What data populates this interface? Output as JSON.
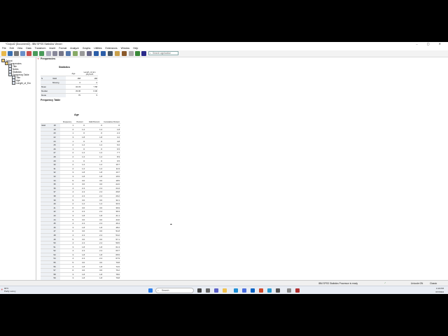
{
  "window": {
    "title": "*Output2 [Document2] - IBM SPSS Statistics Viewer",
    "controls": "– ▢ ✕"
  },
  "menu": [
    "File",
    "Edit",
    "View",
    "Data",
    "Transform",
    "Insert",
    "Format",
    "Analyze",
    "Graphs",
    "Utilities",
    "Extensions",
    "Window",
    "Help"
  ],
  "toolbar": {
    "search_placeholder": "Search application"
  },
  "outline": [
    {
      "label": "Output",
      "indent": 0,
      "y": 2
    },
    {
      "label": "Frequencies",
      "indent": 1,
      "y": 6
    },
    {
      "label": "Title",
      "indent": 2,
      "y": 10
    },
    {
      "label": "Notes",
      "indent": 2,
      "y": 14
    },
    {
      "label": "Statistics",
      "indent": 2,
      "y": 18
    },
    {
      "label": "Frequency Table",
      "indent": 2,
      "y": 22
    },
    {
      "label": "Title",
      "indent": 3,
      "y": 26
    },
    {
      "label": "Age",
      "indent": 3,
      "y": 30
    },
    {
      "label": "Length_of_Em",
      "indent": 3,
      "y": 34
    }
  ],
  "content": {
    "frequencies_title": "Frequencies",
    "statistics": {
      "title": "Statistics",
      "col1": "Age",
      "col2": "Length_of_Em ployment",
      "rows": [
        {
          "l1": "N",
          "l2": "Valid",
          "v1": "168",
          "v2": "168"
        },
        {
          "l1": "",
          "l2": "Missing",
          "v1": "0",
          "v2": "0"
        },
        {
          "l1": "Mean",
          "l2": "",
          "v1": "34.33",
          "v2": "7.58"
        },
        {
          "l1": "Median",
          "l2": "",
          "v1": "33.00",
          "v2": "6.00"
        },
        {
          "l1": "Mode",
          "l2": "",
          "v1": "75",
          "v2": "5"
        }
      ]
    },
    "frequency_table_title": "Frequency Table",
    "age_table": {
      "title": "Age",
      "headers": [
        "Frequency",
        "Percent",
        "Valid Percent",
        "Cumulative Percent"
      ],
      "valid_label": "Valid",
      "rows": [
        [
          "18",
          "1",
          ".6",
          ".6",
          ".6"
        ],
        [
          "19",
          "2",
          "1.2",
          "1.2",
          "1.8"
        ],
        [
          "20",
          "1",
          ".6",
          ".6",
          "2.4"
        ],
        [
          "22",
          "3",
          "1.8",
          "1.8",
          "4.2"
        ],
        [
          "24",
          "1",
          ".6",
          ".6",
          "4.8"
        ],
        [
          "25",
          "2",
          "1.2",
          "1.2",
          "6.0"
        ],
        [
          "26",
          "1",
          ".6",
          ".6",
          "6.5"
        ],
        [
          "27",
          "2",
          "1.2",
          "1.2",
          "7.7"
        ],
        [
          "28",
          "2",
          "1.2",
          "1.2",
          "8.9"
        ],
        [
          "29",
          "1",
          ".6",
          ".6",
          "9.5"
        ],
        [
          "30",
          "2",
          "1.2",
          "1.2",
          "10.7"
        ],
        [
          "31",
          "2",
          "1.2",
          "1.2",
          "11.9"
        ],
        [
          "32",
          "3",
          "1.8",
          "1.8",
          "13.7"
        ],
        [
          "33",
          "3",
          "1.8",
          "1.8",
          "15.5"
        ],
        [
          "34",
          "5",
          "3.0",
          "3.0",
          "18.5"
        ],
        [
          "35",
          "6",
          "3.6",
          "3.6",
          "22.0"
        ],
        [
          "36",
          "4",
          "2.4",
          "2.4",
          "24.4"
        ],
        [
          "37",
          "4",
          "2.4",
          "2.4",
          "26.8"
        ],
        [
          "38",
          "4",
          "2.4",
          "2.4",
          "29.2"
        ],
        [
          "39",
          "5",
          "3.0",
          "3.0",
          "32.1"
        ],
        [
          "40",
          "2",
          "1.2",
          "1.2",
          "33.3"
        ],
        [
          "41",
          "6",
          "3.6",
          "3.6",
          "36.9"
        ],
        [
          "42",
          "4",
          "2.4",
          "2.4",
          "39.3"
        ],
        [
          "43",
          "3",
          "1.8",
          "1.8",
          "41.1"
        ],
        [
          "44",
          "5",
          "3.0",
          "3.0",
          "44.0"
        ],
        [
          "45",
          "4",
          "2.4",
          "2.4",
          "46.4"
        ],
        [
          "46",
          "3",
          "1.8",
          "1.8",
          "48.2"
        ],
        [
          "47",
          "6",
          "3.6",
          "3.6",
          "51.8"
        ],
        [
          "48",
          "4",
          "2.4",
          "2.4",
          "54.2"
        ],
        [
          "49",
          "5",
          "3.0",
          "3.0",
          "57.1"
        ],
        [
          "50",
          "4",
          "2.4",
          "2.4",
          "59.5"
        ],
        [
          "51",
          "3",
          "1.8",
          "1.8",
          "61.3"
        ],
        [
          "52",
          "4",
          "2.4",
          "2.4",
          "63.7"
        ],
        [
          "53",
          "3",
          "1.8",
          "1.8",
          "65.5"
        ],
        [
          "54",
          "4",
          "2.4",
          "2.4",
          "67.9"
        ],
        [
          "55",
          "5",
          "3.0",
          "3.0",
          "70.8"
        ],
        [
          "56",
          "3",
          "1.8",
          "1.8",
          "72.6"
        ],
        [
          "57",
          "6",
          "3.6",
          "3.6",
          "76.2"
        ],
        [
          "58",
          "3",
          "1.8",
          "1.8",
          "78.0"
        ],
        [
          "59",
          "3",
          "1.8",
          "1.8",
          "79.8"
        ],
        [
          "60",
          "6",
          "3.6",
          "3.6",
          "83.3"
        ],
        [
          "61",
          "4",
          "2.4",
          "2.4",
          "85.7"
        ],
        [
          "62",
          "3",
          "1.8",
          "1.8",
          "87.5"
        ],
        [
          "63",
          "2",
          "1.2",
          "1.2",
          "88.7"
        ],
        [
          "64",
          "4",
          "2.4",
          "2.4",
          "91.1"
        ],
        [
          "65",
          "3",
          "1.8",
          "1.8",
          "92.9"
        ],
        [
          "66",
          "1",
          ".6",
          ".6",
          "93.5"
        ],
        [
          "67",
          "1",
          ".6",
          ".6",
          "94.0"
        ]
      ]
    }
  },
  "statusbar": {
    "processor": "IBM SPSS Statistics Processor is ready",
    "encoding": "Unicode:ON",
    "mode": "Classic"
  },
  "taskbar": {
    "weather_temp": "65°F",
    "weather_desc": "Partly sunny",
    "search_placeholder": "Search",
    "time": "4:19 PM",
    "date": "6/7/2024"
  }
}
